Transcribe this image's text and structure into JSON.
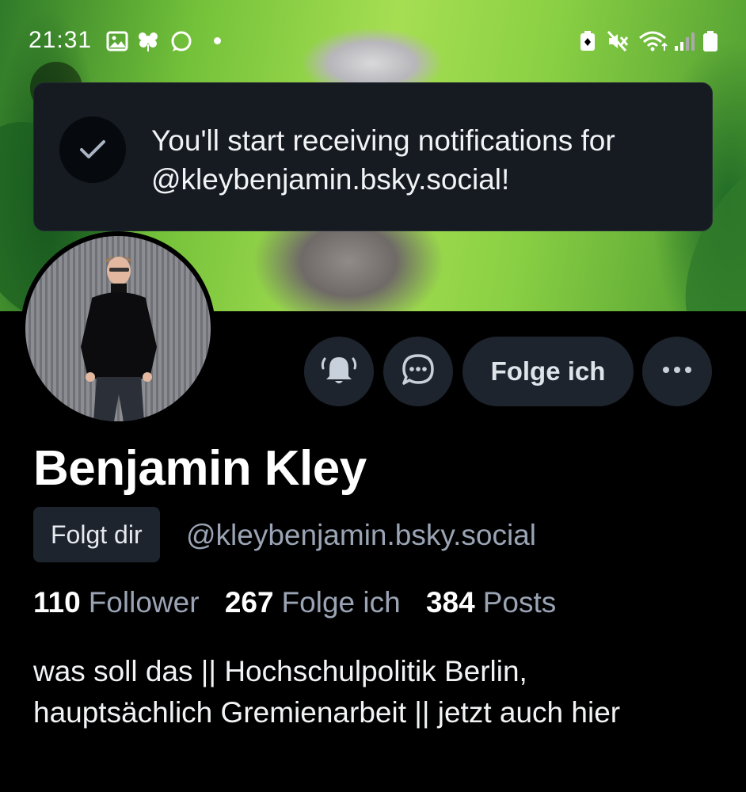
{
  "status_bar": {
    "time": "21:31",
    "left_icons": [
      "image-icon",
      "flower-icon",
      "chat-bubble-icon",
      "dot-icon"
    ],
    "right_icons": [
      "battery-saver-icon",
      "mute-icon",
      "wifi-icon",
      "signal-icon",
      "battery-icon"
    ]
  },
  "toast": {
    "message": "You'll start receiving notifications for @kleybenjamin.bsky.social!",
    "icon": "check-icon"
  },
  "profile": {
    "display_name": "Benjamin Kley",
    "follows_you_label": "Folgt dir",
    "handle": "@kleybenjamin.bsky.social",
    "stats": {
      "followers_count": "110",
      "followers_label": "Follower",
      "following_count": "267",
      "following_label": "Folge ich",
      "posts_count": "384",
      "posts_label": "Posts"
    },
    "bio": "was soll das || Hochschulpolitik Berlin, hauptsächlich Gremienarbeit || jetzt auch hier"
  },
  "actions": {
    "notifications_icon": "bell-ringing-icon",
    "message_icon": "chat-icon",
    "follow_button_label": "Folge ich",
    "more_icon": "more-horizontal-icon"
  },
  "colors": {
    "background": "#000000",
    "surface": "#1e242d",
    "toast_bg": "#161b22",
    "muted_text": "#9aa4b4",
    "primary_text": "#ffffff"
  }
}
